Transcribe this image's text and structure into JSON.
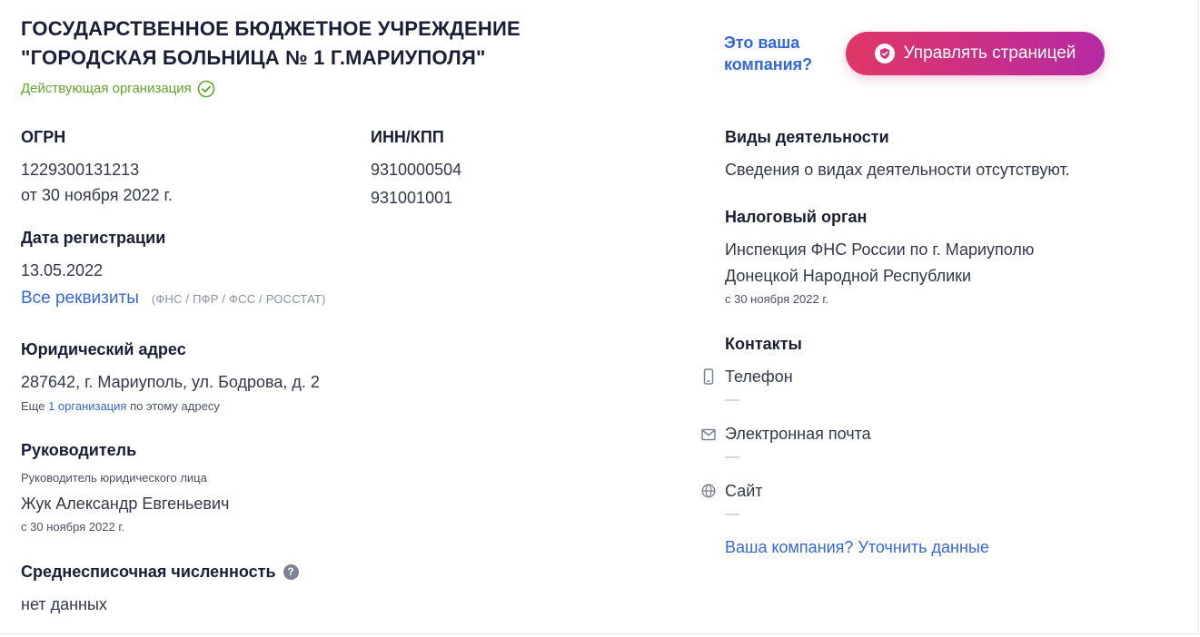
{
  "company": {
    "title_line1": "ГОСУДАРСТВЕННОЕ БЮДЖЕТНОЕ УЧРЕЖДЕНИЕ",
    "title_line2": "\"ГОРОДСКАЯ БОЛЬНИЦА № 1 Г.МАРИУПОЛЯ\"",
    "status": "Действующая организация"
  },
  "cta": {
    "question": "Это ваша компания?",
    "button_label": "Управлять страницей"
  },
  "ogrn": {
    "label": "ОГРН",
    "value": "1229300131213",
    "date": "от 30 ноября 2022 г."
  },
  "inn_kpp": {
    "label": "ИНН/КПП",
    "inn": "9310000504",
    "kpp": "931001001"
  },
  "registration": {
    "label": "Дата регистрации",
    "date": "13.05.2022",
    "all_details_link": "Все реквизиты",
    "sources": "(ФНС / ПФР / ФСС / РОССТАТ)"
  },
  "address": {
    "label": "Юридический адрес",
    "value": "287642, г. Мариуполь, ул. Бодрова, д. 2",
    "more_prefix": "Еще",
    "more_link": "1 организация",
    "more_suffix": "по этому адресу"
  },
  "director": {
    "label": "Руководитель",
    "role": "Руководитель юридического лица",
    "name": "Жук Александр Евгеньевич",
    "since": "с 30 ноября 2022 г."
  },
  "headcount": {
    "label": "Среднесписочная численность",
    "help_icon": "?",
    "value": "нет данных"
  },
  "activities": {
    "label": "Виды деятельности",
    "value": "Сведения о видах деятельности отсутствуют."
  },
  "tax_authority": {
    "label": "Налоговый орган",
    "line1": "Инспекция ФНС России по г. Мариуполю",
    "line2": "Донецкой Народной Республики",
    "since": "с 30 ноября 2022 г."
  },
  "contacts": {
    "label": "Контакты",
    "phone_label": "Телефон",
    "phone_value": "—",
    "email_label": "Электронная почта",
    "email_value": "—",
    "site_label": "Сайт",
    "site_value": "—",
    "update_link": "Ваша компания? Уточнить данные",
    "phone_icon": "phone-icon",
    "email_icon": "mail-icon",
    "site_icon": "globe-icon"
  }
}
